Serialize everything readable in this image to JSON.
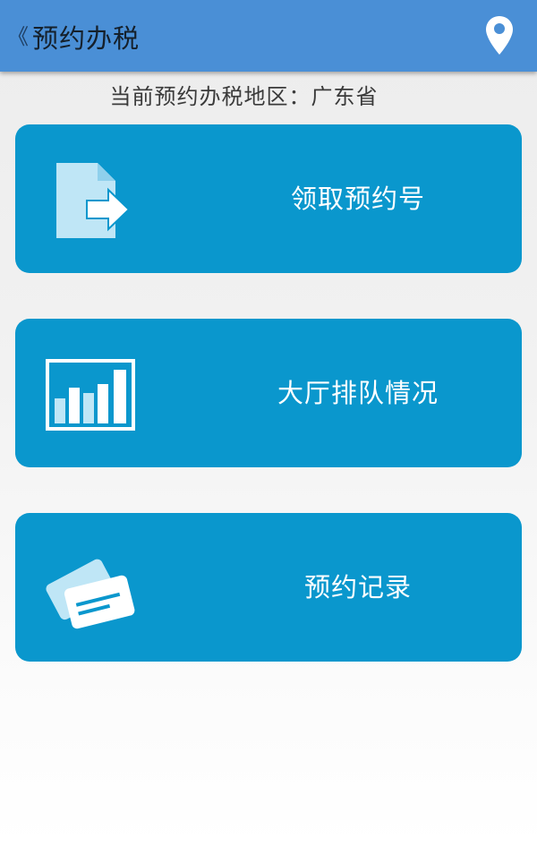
{
  "header": {
    "back_icon": "chevron-left-icon",
    "title": "预约办税",
    "location_icon": "map-pin-icon"
  },
  "region": {
    "text": "当前预约办税地区：广东省"
  },
  "menu": [
    {
      "label": "领取预约号",
      "icon": "document-export-icon"
    },
    {
      "label": "大厅排队情况",
      "icon": "bar-chart-icon"
    },
    {
      "label": "预约记录",
      "icon": "cards-icon"
    }
  ],
  "colors": {
    "app_bar": "#4a8fd6",
    "card": "#0a97cd",
    "icon_light": "#bfe6f6",
    "icon_white": "#ffffff"
  }
}
